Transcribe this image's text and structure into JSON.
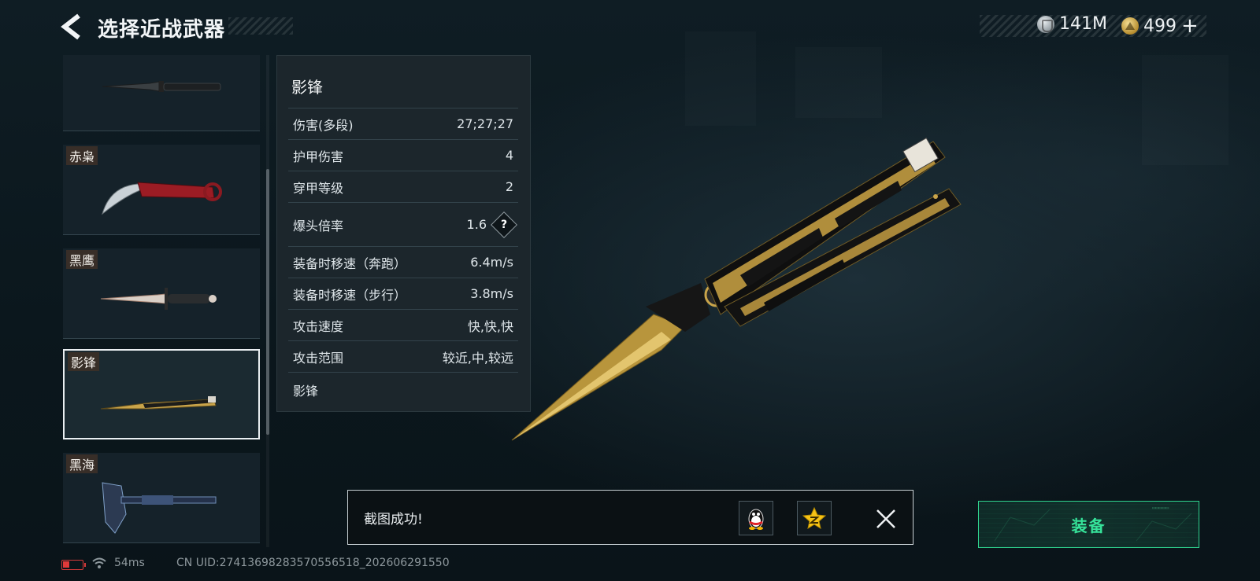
{
  "header": {
    "title": "选择近战武器"
  },
  "currency": {
    "silver": "141M",
    "gold": "499",
    "plus": "+"
  },
  "weapons": [
    {
      "name": ""
    },
    {
      "name": "赤枭"
    },
    {
      "name": "黑鹰"
    },
    {
      "name": "影锋"
    },
    {
      "name": "黑海"
    }
  ],
  "stats": {
    "title": "影锋",
    "rows": [
      {
        "label": "伤害(多段)",
        "value": "27;27;27"
      },
      {
        "label": "护甲伤害",
        "value": "4"
      },
      {
        "label": "穿甲等级",
        "value": "2"
      },
      {
        "label": "爆头倍率",
        "value": "1.6"
      },
      {
        "label": "装备时移速（奔跑）",
        "value": "6.4m/s"
      },
      {
        "label": "装备时移速（步行）",
        "value": "3.8m/s"
      },
      {
        "label": "攻击速度",
        "value": "快,快,快"
      },
      {
        "label": "攻击范围",
        "value": "较近,中,较远"
      }
    ],
    "footer": "影锋",
    "help_glyph": "?"
  },
  "toast": {
    "message": "截图成功!"
  },
  "equip": {
    "label": "装备"
  },
  "status": {
    "ping": "54ms",
    "uid": "CN UID:27413698283570556518_202606291550"
  },
  "colors": {
    "accent_green": "#36e39a",
    "gold": "#c9a44a",
    "battery_red": "#e03a3a"
  },
  "icons": {
    "back": "chevron-left-icon",
    "silver_coin": "silver-coin-icon",
    "gold_coin": "gold-coin-icon",
    "help": "question-diamond-icon",
    "qq_share": "qq-penguin-icon",
    "qzone_share": "qzone-star-icon",
    "close": "close-icon",
    "battery": "battery-low-icon",
    "wifi": "wifi-icon"
  }
}
